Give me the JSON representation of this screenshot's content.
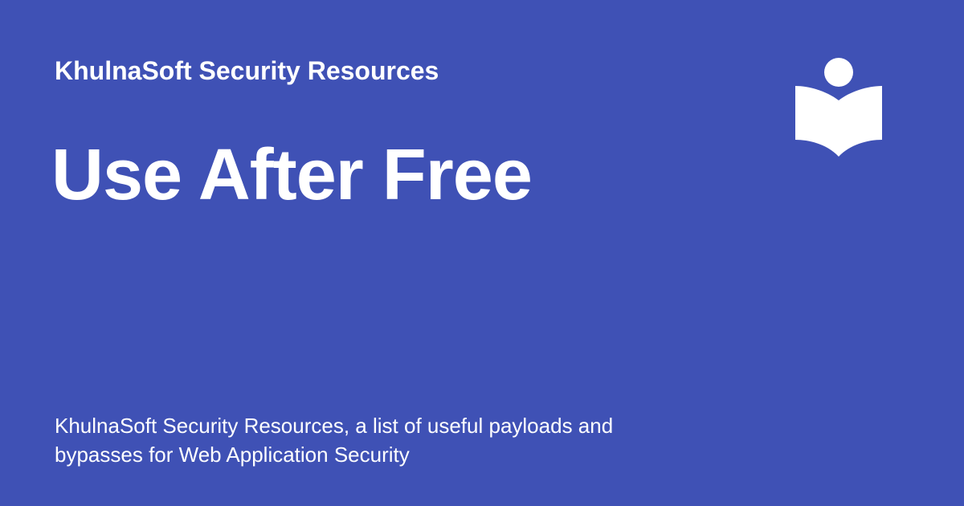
{
  "site": {
    "name": "KhulnaSoft Security Resources",
    "logo_icon": "reader-book-icon"
  },
  "page": {
    "title": "Use After Free",
    "description": "KhulnaSoft Security Resources, a list of useful payloads and bypasses for Web Application Security"
  },
  "colors": {
    "background": "#3f51b5",
    "foreground": "#ffffff"
  }
}
